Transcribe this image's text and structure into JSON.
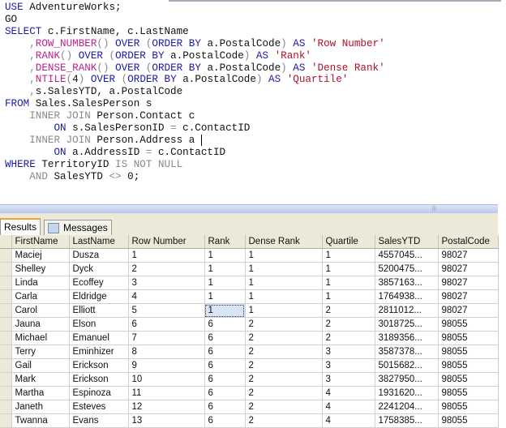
{
  "editor": {
    "lines": [
      [
        [
          "kw",
          "USE"
        ],
        [
          "tx",
          " AdventureWorks;"
        ]
      ],
      [
        [
          "tx",
          "GO"
        ]
      ],
      [
        [
          "kw",
          "SELECT"
        ],
        [
          "tx",
          " c.FirstName, c.LastName"
        ]
      ],
      [
        [
          "gr",
          "    ,"
        ],
        [
          "fn",
          "ROW_NUMBER"
        ],
        [
          "gr",
          "() "
        ],
        [
          "kw",
          "OVER"
        ],
        [
          "gr",
          " ("
        ],
        [
          "kw",
          "ORDER BY"
        ],
        [
          "tx",
          " a.PostalCode"
        ],
        [
          "gr",
          ") "
        ],
        [
          "kw",
          "AS"
        ],
        [
          "str",
          " 'Row Number'"
        ]
      ],
      [
        [
          "gr",
          "    ,"
        ],
        [
          "fn",
          "RANK"
        ],
        [
          "gr",
          "() "
        ],
        [
          "kw",
          "OVER"
        ],
        [
          "gr",
          " ("
        ],
        [
          "kw",
          "ORDER BY"
        ],
        [
          "tx",
          " a.PostalCode"
        ],
        [
          "gr",
          ") "
        ],
        [
          "kw",
          "AS"
        ],
        [
          "str",
          " 'Rank'"
        ]
      ],
      [
        [
          "gr",
          "    ,"
        ],
        [
          "fn",
          "DENSE_RANK"
        ],
        [
          "gr",
          "() "
        ],
        [
          "kw",
          "OVER"
        ],
        [
          "gr",
          " ("
        ],
        [
          "kw",
          "ORDER BY"
        ],
        [
          "tx",
          " a.PostalCode"
        ],
        [
          "gr",
          ") "
        ],
        [
          "kw",
          "AS"
        ],
        [
          "str",
          " 'Dense Rank'"
        ]
      ],
      [
        [
          "gr",
          "    ,"
        ],
        [
          "fn",
          "NTILE"
        ],
        [
          "gr",
          "("
        ],
        [
          "tx",
          "4"
        ],
        [
          "gr",
          ") "
        ],
        [
          "kw",
          "OVER"
        ],
        [
          "gr",
          " ("
        ],
        [
          "kw",
          "ORDER BY"
        ],
        [
          "tx",
          " a.PostalCode"
        ],
        [
          "gr",
          ") "
        ],
        [
          "kw",
          "AS"
        ],
        [
          "str",
          " 'Quartile'"
        ]
      ],
      [
        [
          "gr",
          "    ,"
        ],
        [
          "tx",
          "s.SalesYTD, a.PostalCode"
        ]
      ],
      [
        [
          "kw",
          "FROM"
        ],
        [
          "tx",
          " Sales.SalesPerson s"
        ]
      ],
      [
        [
          "gr",
          "    INNER JOIN"
        ],
        [
          "tx",
          " Person.Contact c"
        ]
      ],
      [
        [
          "kw",
          "        ON"
        ],
        [
          "tx",
          " s.SalesPersonID "
        ],
        [
          "gr",
          "="
        ],
        [
          "tx",
          " c.ContactID"
        ]
      ],
      [
        [
          "gr",
          "    INNER JOIN"
        ],
        [
          "tx",
          " Person.Address a "
        ],
        [
          "caret",
          ""
        ]
      ],
      [
        [
          "kw",
          "        ON"
        ],
        [
          "tx",
          " a.AddressID "
        ],
        [
          "gr",
          "="
        ],
        [
          "tx",
          " c.ContactID"
        ]
      ],
      [
        [
          "kw",
          "WHERE"
        ],
        [
          "tx",
          " TerritoryID "
        ],
        [
          "gr",
          "IS NOT NULL"
        ]
      ],
      [
        [
          "gr",
          "    AND"
        ],
        [
          "tx",
          " SalesYTD "
        ],
        [
          "gr",
          "<>"
        ],
        [
          "tx",
          " 0;"
        ]
      ]
    ]
  },
  "tabs": {
    "results": "Results",
    "messages": "Messages"
  },
  "grid": {
    "columns": [
      "FirstName",
      "LastName",
      "Row Number",
      "Rank",
      "Dense Rank",
      "Quartile",
      "SalesYTD",
      "PostalCode"
    ],
    "rows": [
      [
        "Maciej",
        "Dusza",
        "1",
        "1",
        "1",
        "1",
        "4557045...",
        "98027"
      ],
      [
        "Shelley",
        "Dyck",
        "2",
        "1",
        "1",
        "1",
        "5200475...",
        "98027"
      ],
      [
        "Linda",
        "Ecoffey",
        "3",
        "1",
        "1",
        "1",
        "3857163...",
        "98027"
      ],
      [
        "Carla",
        "Eldridge",
        "4",
        "1",
        "1",
        "1",
        "1764938...",
        "98027"
      ],
      [
        "Carol",
        "Elliott",
        "5",
        "1",
        "1",
        "2",
        "2811012...",
        "98027"
      ],
      [
        "Jauna",
        "Elson",
        "6",
        "6",
        "2",
        "2",
        "3018725...",
        "98055"
      ],
      [
        "Michael",
        "Emanuel",
        "7",
        "6",
        "2",
        "2",
        "3189356...",
        "98055"
      ],
      [
        "Terry",
        "Eminhizer",
        "8",
        "6",
        "2",
        "3",
        "3587378...",
        "98055"
      ],
      [
        "Gail",
        "Erickson",
        "9",
        "6",
        "2",
        "3",
        "5015682...",
        "98055"
      ],
      [
        "Mark",
        "Erickson",
        "10",
        "6",
        "2",
        "3",
        "3827950...",
        "98055"
      ],
      [
        "Martha",
        "Espinoza",
        "11",
        "6",
        "2",
        "4",
        "1931620...",
        "98055"
      ],
      [
        "Janeth",
        "Esteves",
        "12",
        "6",
        "2",
        "4",
        "2241204...",
        "98055"
      ],
      [
        "Twanna",
        "Evans",
        "13",
        "6",
        "2",
        "4",
        "1758385...",
        "98055"
      ]
    ]
  }
}
